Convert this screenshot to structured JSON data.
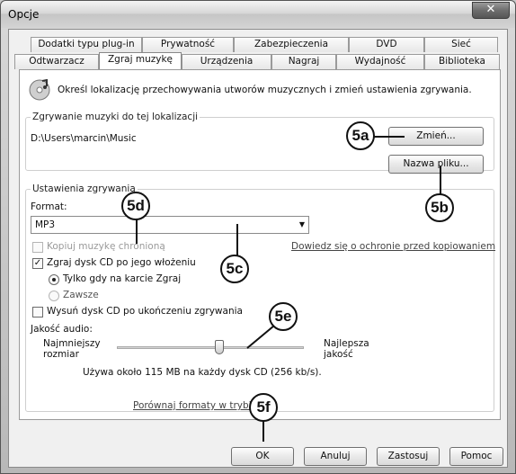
{
  "window": {
    "title": "Opcje",
    "close_glyph": "✕"
  },
  "tabs": {
    "top_row": [
      "Dodatki typu plug-in",
      "Prywatność",
      "Zabezpieczenia",
      "DVD",
      "Sieć"
    ],
    "bottom_row": [
      "Odtwarzacz",
      "Zgraj muzykę",
      "Urządzenia",
      "Nagraj",
      "Wydajność",
      "Biblioteka"
    ],
    "selected": "Zgraj muzykę"
  },
  "header": {
    "description": "Określ lokalizację przechowywania utworów muzycznych i zmień ustawienia zgrywania.",
    "icon": "cd-music-icon"
  },
  "location_group": {
    "label": "Zgrywanie muzyki do tej lokalizacji",
    "path": "D:\\Users\\marcin\\Music",
    "change_button": "Zmień...",
    "filename_button": "Nazwa pliku..."
  },
  "rip_settings": {
    "label": "Ustawienia zgrywania",
    "format_label": "Format:",
    "format_value": "MP3",
    "copy_protect_label": "Kopiuj muzykę chronioną",
    "copy_protect_link": "Dowiedz się o ochronie przed kopiowaniem",
    "rip_on_insert_label": "Zgraj dysk CD po jego włożeniu",
    "only_on_rip_tab_label": "Tylko gdy na karcie Zgraj",
    "always_label": "Zawsze",
    "eject_label": "Wysuń dysk CD po ukończeniu zgrywania",
    "audio_quality_label": "Jakość audio:",
    "min_size_label": "Najmniejszy rozmiar",
    "best_quality_label": "Najlepsza jakość",
    "slider_level": 0.55,
    "usage_text": "Używa około 115 MB na każdy dysk CD (256 kb/s).",
    "compare_link": "Porównaj formaty w trybie onli"
  },
  "buttons": {
    "ok": "OK",
    "cancel": "Anuluj",
    "apply": "Zastosuj",
    "help": "Pomoc"
  },
  "callouts": [
    "5a",
    "5b",
    "5c",
    "5d",
    "5e",
    "5f"
  ]
}
